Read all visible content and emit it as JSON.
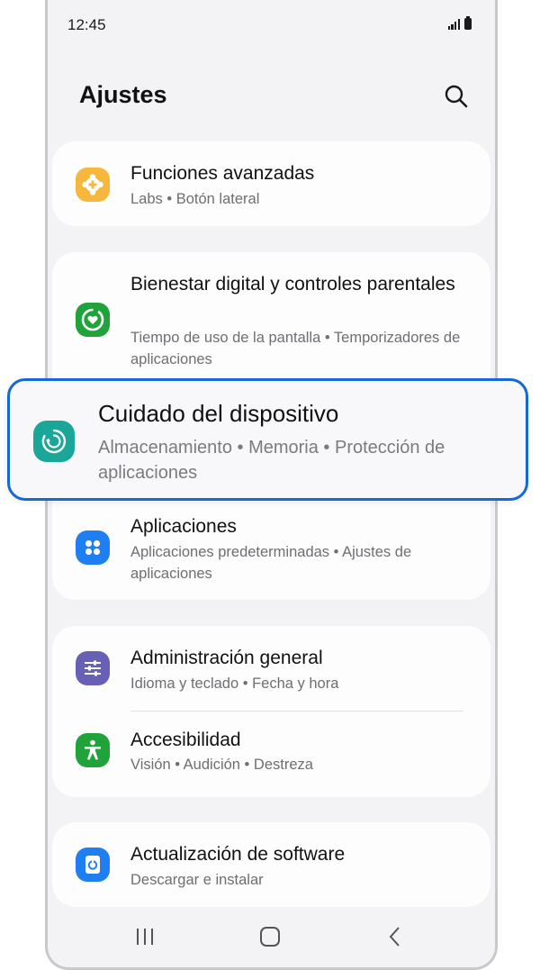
{
  "status": {
    "time": "12:45"
  },
  "header": {
    "title": "Ajustes"
  },
  "items": [
    {
      "title": "Funciones avanzadas",
      "sub": "Labs  •  Botón lateral",
      "icon": "advanced-features-icon",
      "color": "#f6b73c"
    },
    {
      "title": "Bienestar digital y controles parentales",
      "sub": "Tiempo de uso de la pantalla  •  Temporizadores de aplicaciones",
      "icon": "digital-wellbeing-icon",
      "color": "#1fa33a"
    },
    {
      "title": "Aplicaciones",
      "sub": "Aplicaciones predeterminadas  •  Ajustes de aplicaciones",
      "icon": "apps-icon",
      "color": "#1f7ef0"
    },
    {
      "title": "Administración general",
      "sub": "Idioma y teclado  •  Fecha y hora",
      "icon": "general-management-icon",
      "color": "#6760b5"
    },
    {
      "title": "Accesibilidad",
      "sub": "Visión  •  Audición  •  Destreza",
      "icon": "accessibility-icon",
      "color": "#1fa33a"
    },
    {
      "title": "Actualización de software",
      "sub": "Descargar e instalar",
      "icon": "software-update-icon",
      "color": "#1f7ef0"
    }
  ],
  "highlighted": {
    "title": "Cuidado del dispositivo",
    "sub": "Almacenamiento  •  Memoria  •  Protección de aplicaciones",
    "icon": "device-care-icon",
    "color": "#1aa79a",
    "border_color": "#1569d6"
  },
  "navbar": {
    "icons": [
      "recents-icon",
      "home-icon",
      "back-icon"
    ]
  }
}
